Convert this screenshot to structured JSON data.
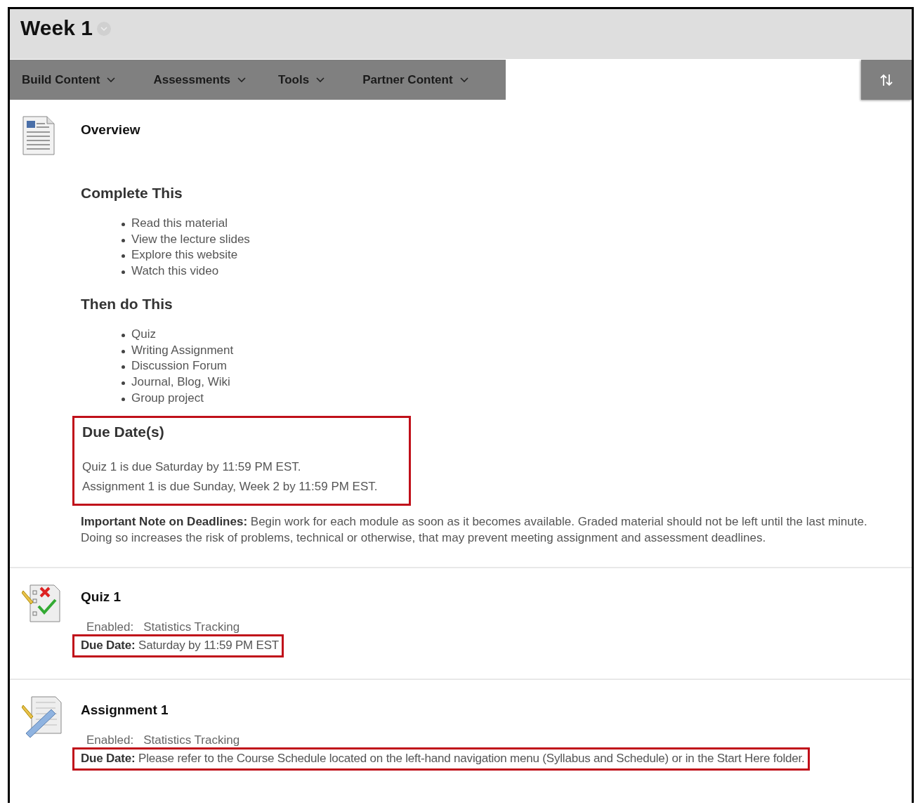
{
  "page_title": "Week 1",
  "toolbar": [
    {
      "label": "Build Content"
    },
    {
      "label": "Assessments"
    },
    {
      "label": "Tools"
    },
    {
      "label": "Partner Content"
    }
  ],
  "items": [
    {
      "kind": "document",
      "title": "Overview",
      "sections": [
        {
          "heading": "Complete This",
          "list": [
            "Read this material",
            "View the lecture slides",
            "Explore this website",
            "Watch this video"
          ]
        },
        {
          "heading": "Then do This",
          "list": [
            "Quiz",
            "Writing Assignment",
            "Discussion Forum",
            "Journal, Blog, Wiki",
            "Group project"
          ]
        }
      ],
      "due_box": {
        "heading": "Due Date(s)",
        "lines": [
          "Quiz 1 is due Saturday by 11:59 PM EST.",
          "Assignment 1 is due Sunday, Week 2 by 11:59 PM EST."
        ],
        "highlighted": true
      },
      "note": "**Important Note on Deadlines:** Begin work for each module as soon as it becomes available. Graded material should not be left until the last minute. Doing so increases the risk of problems, technical or otherwise, that may prevent meeting assignment and assessment deadlines."
    },
    {
      "kind": "quiz",
      "title": "Quiz 1",
      "enabled_label": "Enabled:",
      "enabled_value": "Statistics Tracking",
      "due_label": "Due Date:",
      "due_value": "Saturday by 11:59 PM EST",
      "highlighted": true
    },
    {
      "kind": "assignment",
      "title": "Assignment 1",
      "enabled_label": "Enabled:",
      "enabled_value": "Statistics Tracking",
      "due_label": "Due Date:",
      "due_value": "Please refer to the Course Schedule located on the left-hand navigation menu (Syllabus and Schedule) or in the Start Here folder.",
      "highlighted": true
    }
  ]
}
